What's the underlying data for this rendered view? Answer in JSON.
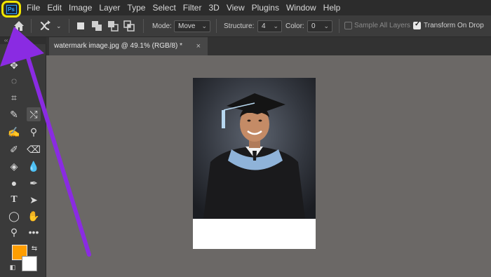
{
  "menu": {
    "app_logo": "Ps",
    "items": [
      "File",
      "Edit",
      "Image",
      "Layer",
      "Type",
      "Select",
      "Filter",
      "3D",
      "View",
      "Plugins",
      "Window",
      "Help"
    ]
  },
  "options": {
    "mode_label": "Mode:",
    "mode_value": "Move",
    "structure_label": "Structure:",
    "structure_value": "4",
    "color_label": "Color:",
    "color_value": "0",
    "sample_all_layers": "Sample All Layers",
    "transform_on_drop": "Transform On Drop",
    "transform_on_drop_checked": true,
    "sample_all_layers_checked": false
  },
  "document": {
    "tab_title": "watermark image.jpg @ 49.1% (RGB/8) *",
    "close_symbol": "×"
  },
  "toolbar": {
    "collapse_symbol": "‹‹",
    "foreground_color": "#ff9e00",
    "background_color": "#ffffff"
  },
  "annotation": {
    "highlight_color": "#f2e600",
    "arrow_color": "#8a2be2"
  }
}
